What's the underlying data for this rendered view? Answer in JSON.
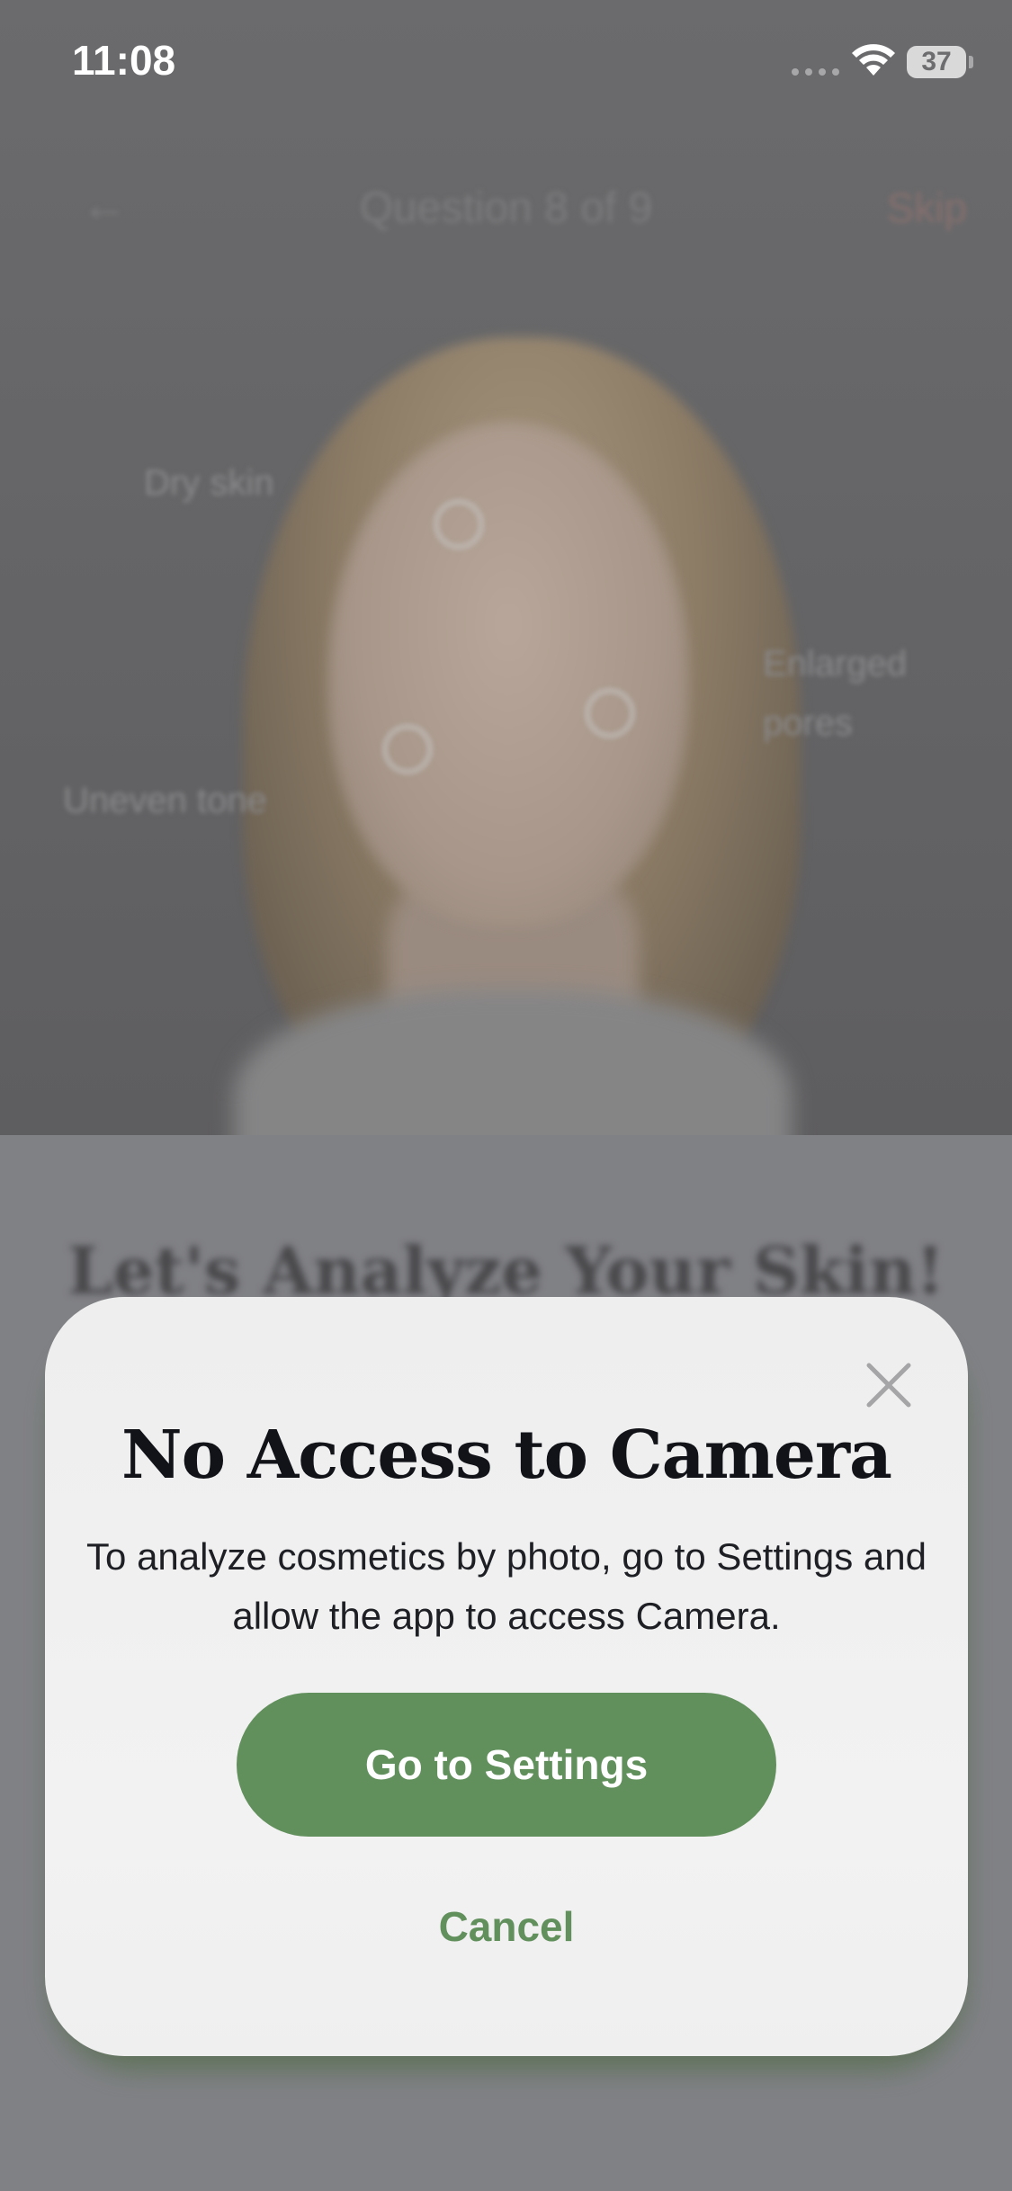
{
  "status_bar": {
    "time": "11:08",
    "battery_level": "37",
    "icons": [
      "signal-icon",
      "wifi-icon",
      "battery-icon"
    ]
  },
  "background": {
    "nav": {
      "back_icon": "arrow-left-icon",
      "title": "Question 8 of 9",
      "skip_label": "Skip"
    },
    "skin_labels": [
      "Dry skin",
      "Enlarged pores",
      "Uneven tone"
    ],
    "heading": "Let's Analyze Your Skin!"
  },
  "modal": {
    "close_icon": "close-icon",
    "title": "No Access to Camera",
    "message": "To analyze cosmetics by photo, go to Settings and allow the app to access Camera.",
    "primary_button": "Go to Settings",
    "cancel_button": "Cancel"
  },
  "colors": {
    "accent_green": "#62905d",
    "title_text": "#111318",
    "modal_background": "#f0f0f0",
    "dim_overlay": "#7f8084"
  }
}
